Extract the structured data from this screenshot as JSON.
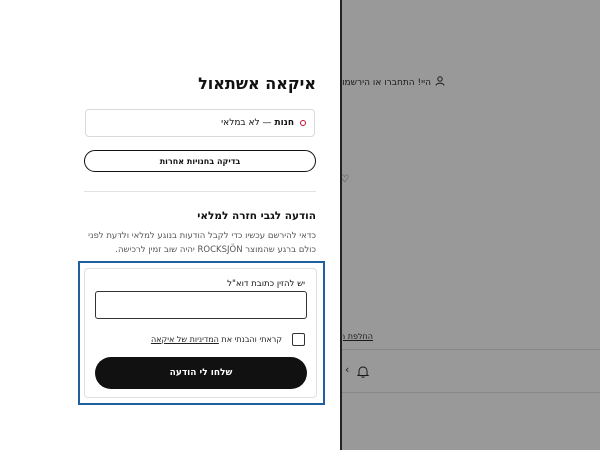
{
  "panel": {
    "title": "איקאה אשתאול",
    "store": {
      "name": "חנות",
      "status": "— לא במלאי",
      "status_color": "#c8102e"
    },
    "check_other_stores_label": "בדיקה בחנויות אחרות",
    "notify": {
      "title": "הודעה לגבי חזרה למלאי",
      "description": "כדאי להירשם עכשיו כדי לקבל הודעות בנוגע למלאי ולדעת לפני כולם ברגע שהמוצר ROCKSJÖN יהיה שוב זמין לרכישה."
    },
    "form": {
      "email_label": "יש להזין כתובת דוא\"ל",
      "email_value": "",
      "email_placeholder": "",
      "consent_prefix": "קראתי והבנתי את ",
      "consent_link": "המדיניות של איקאה",
      "submit_label": "שלחו לי הודעה"
    }
  },
  "background": {
    "login_text": "היי! התחברו או הירשמו",
    "link_text": "החלפת חנות"
  },
  "icons": {
    "user": "user-icon",
    "heart": "heart-icon",
    "chevron": "chevron-left-icon",
    "bell": "bell-icon"
  }
}
